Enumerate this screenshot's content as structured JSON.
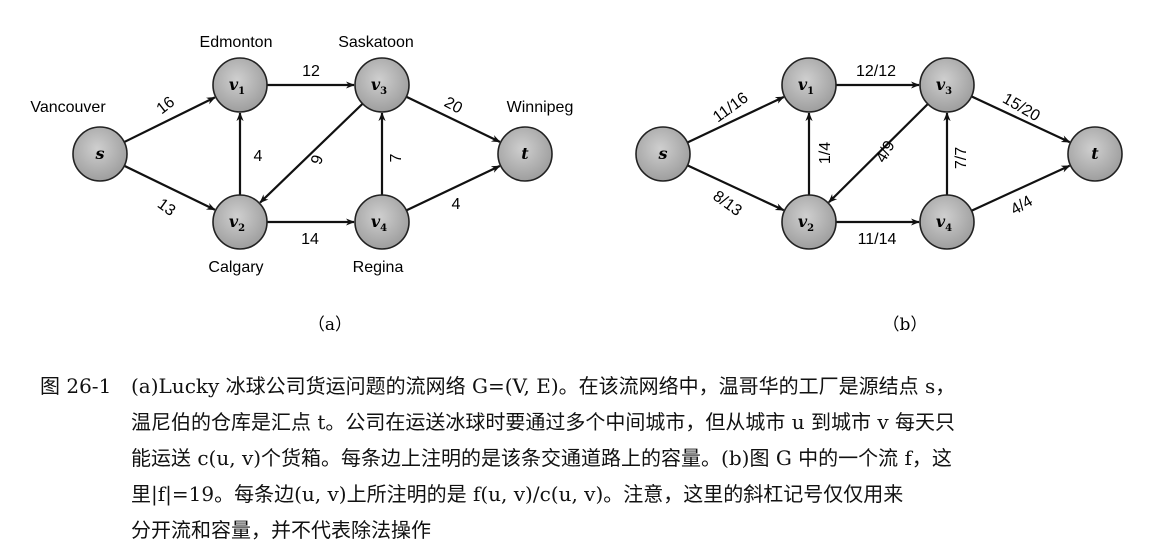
{
  "panel_a": {
    "label": "（a）",
    "nodes": [
      {
        "id": "s",
        "sym": "s",
        "sub": "",
        "city": "Vancouver"
      },
      {
        "id": "v1",
        "sym": "v",
        "sub": "1",
        "city": "Edmonton"
      },
      {
        "id": "v2",
        "sym": "v",
        "sub": "2",
        "city": "Calgary"
      },
      {
        "id": "v3",
        "sym": "v",
        "sub": "3",
        "city": "Saskatoon"
      },
      {
        "id": "v4",
        "sym": "v",
        "sub": "4",
        "city": "Regina"
      },
      {
        "id": "t",
        "sym": "t",
        "sub": "",
        "city": "Winnipeg"
      }
    ],
    "edges": [
      {
        "from": "s",
        "to": "v1",
        "label": "16"
      },
      {
        "from": "s",
        "to": "v2",
        "label": "13"
      },
      {
        "from": "v2",
        "to": "v1",
        "label": "4"
      },
      {
        "from": "v1",
        "to": "v3",
        "label": "12"
      },
      {
        "from": "v3",
        "to": "v2",
        "label": "9"
      },
      {
        "from": "v2",
        "to": "v4",
        "label": "14"
      },
      {
        "from": "v4",
        "to": "v3",
        "label": "7"
      },
      {
        "from": "v3",
        "to": "t",
        "label": "20"
      },
      {
        "from": "v4",
        "to": "t",
        "label": "4"
      }
    ]
  },
  "panel_b": {
    "label": "（b）",
    "nodes": [
      {
        "id": "s",
        "sym": "s",
        "sub": ""
      },
      {
        "id": "v1",
        "sym": "v",
        "sub": "1"
      },
      {
        "id": "v2",
        "sym": "v",
        "sub": "2"
      },
      {
        "id": "v3",
        "sym": "v",
        "sub": "3"
      },
      {
        "id": "v4",
        "sym": "v",
        "sub": "4"
      },
      {
        "id": "t",
        "sym": "t",
        "sub": ""
      }
    ],
    "edges": [
      {
        "from": "s",
        "to": "v1",
        "label": "11/16"
      },
      {
        "from": "s",
        "to": "v2",
        "label": "8/13"
      },
      {
        "from": "v2",
        "to": "v1",
        "label": "1/4"
      },
      {
        "from": "v1",
        "to": "v3",
        "label": "12/12"
      },
      {
        "from": "v3",
        "to": "v2",
        "label": "4/9"
      },
      {
        "from": "v2",
        "to": "v4",
        "label": "11/14"
      },
      {
        "from": "v4",
        "to": "v3",
        "label": "7/7"
      },
      {
        "from": "v3",
        "to": "t",
        "label": "15/20"
      },
      {
        "from": "v4",
        "to": "t",
        "label": "4/4"
      }
    ]
  },
  "caption": {
    "number": "图 26-1",
    "lines": [
      "(a)Lucky 冰球公司货运问题的流网络 G=(V, E)。在该流网络中，温哥华的工厂是源结点 s，",
      "温尼伯的仓库是汇点 t。公司在运送冰球时要通过多个中间城市，但从城市 u 到城市 v 每天只",
      "能运送 c(u, v)个货箱。每条边上注明的是该条交通道路上的容量。(b)图 G 中的一个流 f，这",
      "里|f|=19。每条边(u, v)上所注明的是 f(u, v)/c(u, v)。注意，这里的斜杠记号仅仅用来",
      "分开流和容量，并不代表除法操作"
    ]
  },
  "colors": {
    "node_fill": "#b4b4b4",
    "node_stroke": "#222222",
    "edge": "#111111"
  }
}
